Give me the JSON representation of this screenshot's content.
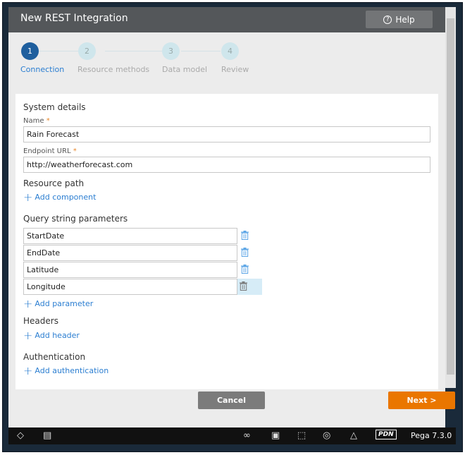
{
  "header": {
    "title": "New REST Integration",
    "help_label": "Help",
    "help_icon": "question-circle-icon"
  },
  "steps": [
    {
      "number": "1",
      "label": "Connection",
      "active": true
    },
    {
      "number": "2",
      "label": "Resource methods",
      "active": false
    },
    {
      "number": "3",
      "label": "Data model",
      "active": false
    },
    {
      "number": "4",
      "label": "Review",
      "active": false
    }
  ],
  "form": {
    "system_details": "System details",
    "name_label": "Name",
    "name_value": "Rain Forecast",
    "endpoint_label": "Endpoint URL",
    "endpoint_value": "http://weatherforecast.com",
    "required_mark": "*",
    "resource_path": "Resource path",
    "add_component": "Add component",
    "query_params": "Query string parameters",
    "params": [
      "StartDate",
      "EndDate",
      "Latitude",
      "Longitude"
    ],
    "add_parameter": "Add parameter",
    "headers": "Headers",
    "add_header": "Add header",
    "authentication": "Authentication",
    "add_authentication": "Add authentication"
  },
  "actions": {
    "cancel": "Cancel",
    "next": "Next >"
  },
  "footer": {
    "pdn": "PDN",
    "version": "Pega 7.3.0"
  },
  "colors": {
    "accent": "#2b7ed1",
    "primary_button": "#ea7600",
    "header": "#54575a",
    "step_active": "#1f5f9e"
  }
}
